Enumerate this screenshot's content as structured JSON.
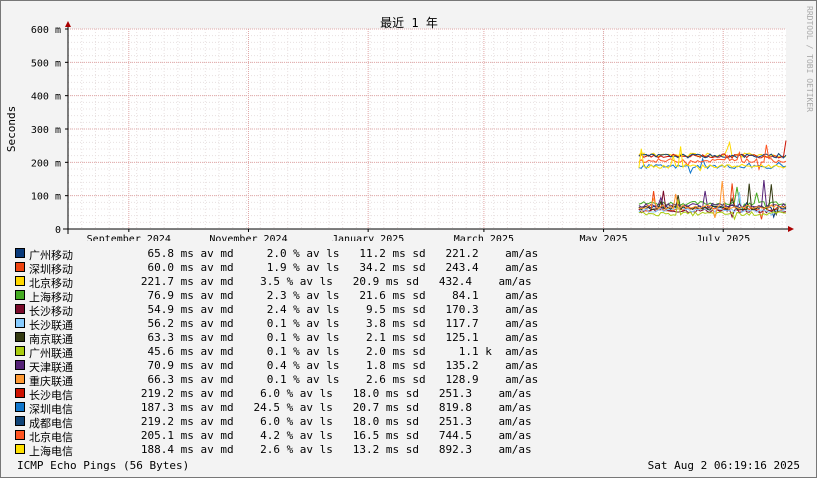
{
  "chart_data": {
    "type": "line",
    "title": "最近 1 年",
    "ylabel": "Seconds",
    "watermark": "RRDTOOL / TOBI OETIKER",
    "ylim": [
      0,
      0.6
    ],
    "y_ticks": [
      {
        "value": 0,
        "label": "0"
      },
      {
        "value": 0.1,
        "label": "100 m"
      },
      {
        "value": 0.2,
        "label": "200 m"
      },
      {
        "value": 0.3,
        "label": "300 m"
      },
      {
        "value": 0.4,
        "label": "400 m"
      },
      {
        "value": 0.5,
        "label": "500 m"
      },
      {
        "value": 0.6,
        "label": "600 m"
      }
    ],
    "xlim": [
      "2024-08-01",
      "2025-08-02"
    ],
    "x_ticks": [
      {
        "date": "2024-09-01",
        "label": "September 2024"
      },
      {
        "date": "2024-11-01",
        "label": "November 2024"
      },
      {
        "date": "2025-01-01",
        "label": "January 2025"
      },
      {
        "date": "2025-03-01",
        "label": "March 2025"
      },
      {
        "date": "2025-05-01",
        "label": "May 2025"
      },
      {
        "date": "2025-07-01",
        "label": "July 2025"
      }
    ],
    "data_start": "2025-05-19",
    "series": [
      {
        "name": "广州移动",
        "color": "#0a3a7a",
        "avg": 0.0658,
        "stats": "65.8 ms av md     2.0 % av ls   11.2 ms sd   221.2    am/as"
      },
      {
        "name": "深圳移动",
        "color": "#ee4411",
        "avg": 0.06,
        "stats": "60.0 ms av md     1.9 % av ls   34.2 ms sd   243.4    am/as"
      },
      {
        "name": "北京移动",
        "color": "#ffd700",
        "avg": 0.2217,
        "stats": "221.7 ms av md    3.5 % av ls   20.9 ms sd   432.4    am/as"
      },
      {
        "name": "上海移动",
        "color": "#44aa22",
        "avg": 0.0769,
        "stats": "76.9 ms av md     2.3 % av ls   21.6 ms sd    84.1    am/as"
      },
      {
        "name": "长沙移动",
        "color": "#7a0a2a",
        "avg": 0.0549,
        "stats": "54.9 ms av md     2.4 % av ls    9.5 ms sd   170.3    am/as"
      },
      {
        "name": "长沙联通",
        "color": "#88ccff",
        "avg": 0.0562,
        "stats": "56.2 ms av md     0.1 % av ls    3.8 ms sd   117.7    am/as"
      },
      {
        "name": "南京联通",
        "color": "#333a11",
        "avg": 0.0633,
        "stats": "63.3 ms av md     0.1 % av ls    2.1 ms sd   125.1    am/as"
      },
      {
        "name": "广州联通",
        "color": "#aacc11",
        "avg": 0.0456,
        "stats": "45.6 ms av md     0.1 % av ls    2.0 ms sd     1.1 k  am/as"
      },
      {
        "name": "天津联通",
        "color": "#552277",
        "avg": 0.0709,
        "stats": "70.9 ms av md     0.4 % av ls    1.8 ms sd   135.2    am/as"
      },
      {
        "name": "重庆联通",
        "color": "#ff9933",
        "avg": 0.0663,
        "stats": "66.3 ms av md     0.1 % av ls    2.6 ms sd   128.9    am/as"
      },
      {
        "name": "长沙电信",
        "color": "#cc1100",
        "avg": 0.2192,
        "stats": "219.2 ms av md    6.0 % av ls   18.0 ms sd   251.3    am/as"
      },
      {
        "name": "深圳电信",
        "color": "#1177cc",
        "avg": 0.1873,
        "stats": "187.3 ms av md   24.5 % av ls   20.7 ms sd   819.8    am/as"
      },
      {
        "name": "成都电信",
        "color": "#114477",
        "avg": 0.2192,
        "stats": "219.2 ms av md    6.0 % av ls   18.0 ms sd   251.3    am/as"
      },
      {
        "name": "北京电信",
        "color": "#ff5522",
        "avg": 0.2051,
        "stats": "205.1 ms av md    4.2 % av ls   16.5 ms sd   744.5    am/as"
      },
      {
        "name": "上海电信",
        "color": "#ffe000",
        "avg": 0.1884,
        "stats": "188.4 ms av md    2.6 % av ls   13.2 ms sd   892.3    am/as"
      }
    ]
  },
  "footer": {
    "left": "ICMP Echo Pings (56 Bytes)",
    "right": "Sat Aug  2 06:19:16 2025"
  }
}
